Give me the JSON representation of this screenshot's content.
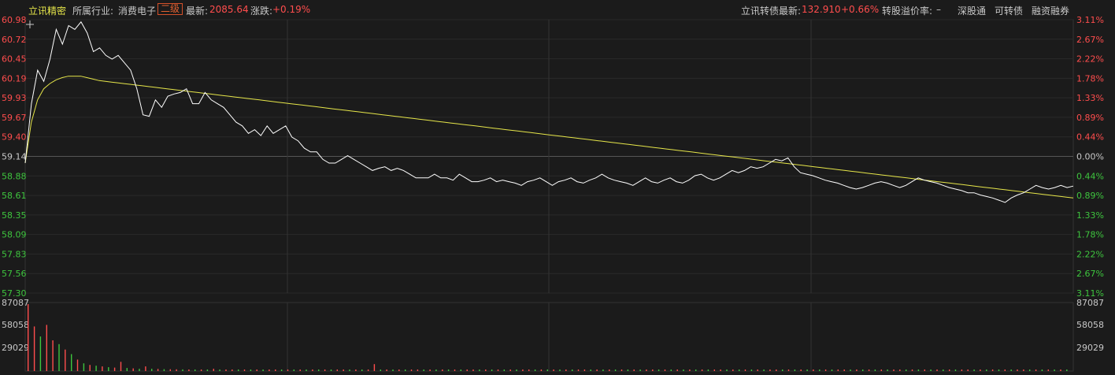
{
  "header": {
    "stock_name": "立讯精密",
    "industry_label": "所属行业:",
    "industry": "消费电子",
    "level_badge": "二级",
    "latest_label": "最新:",
    "latest_value": "2085.64",
    "change_label": "涨跌:",
    "change_value": "+0.19%",
    "bond_label": "立讯转债最新:",
    "bond_price": "132.910",
    "bond_change": "+0.66%",
    "premium_label": "转股溢价率:",
    "premium_value": "–",
    "links": [
      "深股通",
      "可转债",
      "融资融券"
    ]
  },
  "colors": {
    "up": "#ff4d4d",
    "down": "#3ec53e",
    "price_line": "#ffffff",
    "avg_line": "#e6e64a"
  },
  "chart_data": {
    "type": "line",
    "left_ticks": [
      "60.98",
      "60.72",
      "60.45",
      "60.19",
      "59.93",
      "59.67",
      "59.40",
      "59.14",
      "58.88",
      "58.61",
      "58.35",
      "58.09",
      "57.83",
      "57.56",
      "57.30"
    ],
    "right_ticks": [
      "3.11%",
      "2.67%",
      "2.22%",
      "1.78%",
      "1.33%",
      "0.89%",
      "0.44%",
      "0.00%",
      "0.44%",
      "0.89%",
      "1.33%",
      "1.78%",
      "2.22%",
      "2.67%",
      "3.11%"
    ],
    "ylim": [
      57.3,
      60.98
    ],
    "prev_close": 59.14,
    "price": [
      59.05,
      59.85,
      60.3,
      60.15,
      60.45,
      60.85,
      60.65,
      60.9,
      60.85,
      60.95,
      60.8,
      60.55,
      60.6,
      60.5,
      60.45,
      60.5,
      60.4,
      60.3,
      60.05,
      59.7,
      59.68,
      59.9,
      59.8,
      59.95,
      59.98,
      60.0,
      60.05,
      59.85,
      59.85,
      60.0,
      59.9,
      59.85,
      59.8,
      59.7,
      59.6,
      59.55,
      59.45,
      59.5,
      59.42,
      59.55,
      59.45,
      59.5,
      59.55,
      59.4,
      59.35,
      59.25,
      59.2,
      59.2,
      59.1,
      59.05,
      59.05,
      59.1,
      59.15,
      59.1,
      59.05,
      59.0,
      58.95,
      58.98,
      59.0,
      58.95,
      58.98,
      58.95,
      58.9,
      58.85,
      58.85,
      58.85,
      58.9,
      58.85,
      58.85,
      58.82,
      58.9,
      58.85,
      58.8,
      58.8,
      58.82,
      58.85,
      58.8,
      58.82,
      58.8,
      58.78,
      58.75,
      58.8,
      58.82,
      58.85,
      58.8,
      58.75,
      58.8,
      58.82,
      58.85,
      58.8,
      58.78,
      58.82,
      58.85,
      58.9,
      58.85,
      58.82,
      58.8,
      58.78,
      58.75,
      58.8,
      58.85,
      58.8,
      58.78,
      58.82,
      58.85,
      58.8,
      58.78,
      58.82,
      58.88,
      58.9,
      58.85,
      58.82,
      58.85,
      58.9,
      58.95,
      58.92,
      58.95,
      59.0,
      58.98,
      59.0,
      59.05,
      59.1,
      59.08,
      59.12,
      59.0,
      58.92,
      58.9,
      58.88,
      58.85,
      58.82,
      58.8,
      58.78,
      58.75,
      58.72,
      58.7,
      58.72,
      58.75,
      58.78,
      58.8,
      58.78,
      58.75,
      58.72,
      58.75,
      58.8,
      58.85,
      58.82,
      58.8,
      58.78,
      58.75,
      58.72,
      58.7,
      58.68,
      58.65,
      58.65,
      58.62,
      58.6,
      58.58,
      58.55,
      58.52,
      58.58,
      58.62,
      58.65,
      58.7,
      58.75,
      58.72,
      58.7,
      58.72,
      58.75,
      58.72,
      58.74
    ],
    "avg": [
      59.05,
      59.6,
      59.9,
      60.05,
      60.12,
      60.17,
      60.2,
      60.22,
      60.22,
      60.22,
      60.2,
      60.18,
      60.16,
      60.15,
      60.14,
      60.13,
      60.12,
      60.11,
      60.1,
      60.09,
      60.08,
      60.07,
      60.06,
      60.05,
      60.04,
      60.03,
      60.02,
      60.01,
      60.0,
      59.99,
      59.98,
      59.97,
      59.96,
      59.95,
      59.94,
      59.93,
      59.92,
      59.91,
      59.9,
      59.89,
      59.88,
      59.87,
      59.86,
      59.85,
      59.84,
      59.83,
      59.82,
      59.81,
      59.8,
      59.79,
      59.78,
      59.77,
      59.76,
      59.75,
      59.74,
      59.73,
      59.72,
      59.71,
      59.7,
      59.69,
      59.68,
      59.67,
      59.66,
      59.65,
      59.64,
      59.63,
      59.62,
      59.61,
      59.6,
      59.59,
      59.58,
      59.57,
      59.56,
      59.55,
      59.54,
      59.53,
      59.52,
      59.51,
      59.5,
      59.49,
      59.48,
      59.47,
      59.46,
      59.45,
      59.44,
      59.43,
      59.42,
      59.41,
      59.4,
      59.39,
      59.38,
      59.37,
      59.36,
      59.35,
      59.34,
      59.33,
      59.32,
      59.31,
      59.3,
      59.29,
      59.28,
      59.27,
      59.26,
      59.25,
      59.24,
      59.23,
      59.22,
      59.21,
      59.2,
      59.19,
      59.18,
      59.17,
      59.16,
      59.15,
      59.14,
      59.13,
      59.12,
      59.11,
      59.1,
      59.09,
      59.08,
      59.07,
      59.06,
      59.05,
      59.04,
      59.03,
      59.02,
      59.01,
      59.0,
      58.99,
      58.98,
      58.97,
      58.96,
      58.95,
      58.94,
      58.93,
      58.92,
      58.91,
      58.9,
      58.89,
      58.88,
      58.87,
      58.86,
      58.85,
      58.84,
      58.83,
      58.82,
      58.81,
      58.8,
      58.79,
      58.78,
      58.77,
      58.76,
      58.75,
      58.74,
      58.73,
      58.72,
      58.71,
      58.7,
      58.69,
      58.68,
      58.67,
      58.66,
      58.65,
      58.64,
      58.63,
      58.62,
      58.61,
      58.6,
      58.59,
      58.58
    ],
    "volume_ticks": [
      "87087",
      "58058",
      "29029"
    ],
    "volume_max": 87087,
    "volume": [
      87087,
      58000,
      45000,
      60000,
      40000,
      35000,
      28000,
      22000,
      15000,
      10000,
      8000,
      7000,
      6000,
      5000,
      4500,
      12000,
      4000,
      3500,
      3000,
      6000,
      3000,
      2800,
      2500,
      2400,
      2300,
      2200,
      2100,
      2000,
      1900,
      1800,
      3000,
      1800,
      1700,
      1600,
      1500,
      1500,
      1400,
      1400,
      1300,
      1300,
      2000,
      1200,
      1200,
      1100,
      1100,
      1000,
      1000,
      1000,
      1000,
      1000,
      1000,
      1000,
      1000,
      1000,
      1000,
      1000,
      9000,
      1000,
      1000,
      1000,
      1000,
      1000,
      1000,
      1000,
      1000,
      1000,
      1000,
      1000,
      1000,
      1000,
      1000,
      1000,
      1000,
      1000,
      1000,
      1000,
      1000,
      1000,
      1000,
      1000,
      1000,
      1000,
      1000,
      1000,
      1000,
      1000,
      1000,
      1000,
      1000,
      1000,
      1000,
      1000,
      1000,
      1000,
      1000,
      1000,
      1000,
      1000,
      1000,
      1000,
      1000,
      1000,
      1000,
      1000,
      1000,
      1000,
      1000,
      1000,
      1000,
      1000,
      1000,
      1000,
      1000,
      1000,
      1000,
      1000,
      1000,
      1000,
      1000,
      1000,
      1000,
      1000,
      1000,
      1000,
      1000,
      1000,
      1000,
      1000,
      1000,
      1000,
      1000,
      1000,
      1000,
      1000,
      1000,
      1000,
      1000,
      1000,
      1000,
      1000,
      1000,
      1000,
      1000,
      1000,
      1000,
      1000,
      1000,
      1000,
      1000,
      1000,
      1000,
      1000,
      1000,
      1000,
      1000,
      1000,
      1000,
      1000,
      1000,
      1000,
      1000,
      1000,
      1000,
      1000,
      1000,
      1000,
      1000,
      1000,
      1000
    ],
    "volume_up": [
      1,
      1,
      0,
      1,
      1,
      0,
      1,
      0,
      1,
      0,
      1,
      0,
      1,
      0,
      1,
      1,
      0,
      1,
      0,
      1,
      0,
      1,
      0,
      1,
      1,
      0,
      1,
      0,
      1,
      0,
      1,
      0,
      1,
      1,
      0,
      1,
      0,
      1,
      0,
      1,
      1,
      0,
      1,
      0,
      1,
      0,
      1,
      0,
      1,
      0,
      1,
      1,
      0,
      1,
      0,
      1,
      1,
      0,
      1,
      0,
      1,
      0,
      1,
      1,
      0,
      1,
      0,
      1,
      0,
      1,
      0,
      1,
      1,
      0,
      1,
      0,
      1,
      0,
      1,
      0,
      1,
      1,
      0,
      1,
      0,
      1,
      0,
      1,
      0,
      1,
      1,
      0,
      1,
      0,
      1,
      0,
      1,
      0,
      1,
      0,
      1,
      1,
      0,
      1,
      0,
      1,
      0,
      1,
      0,
      1,
      0,
      1,
      1,
      0,
      1,
      0,
      1,
      0,
      1,
      0,
      1,
      1,
      0,
      1,
      0,
      1,
      0,
      1,
      0,
      1,
      0,
      1,
      1,
      0,
      1,
      0,
      1,
      0,
      1,
      0,
      1,
      1,
      0,
      1,
      0,
      1,
      0,
      1,
      0,
      1,
      0,
      1,
      1,
      0,
      1,
      0,
      1,
      0,
      1,
      0,
      1,
      1,
      0,
      1,
      0,
      1,
      0,
      1,
      0,
      1,
      0
    ]
  }
}
